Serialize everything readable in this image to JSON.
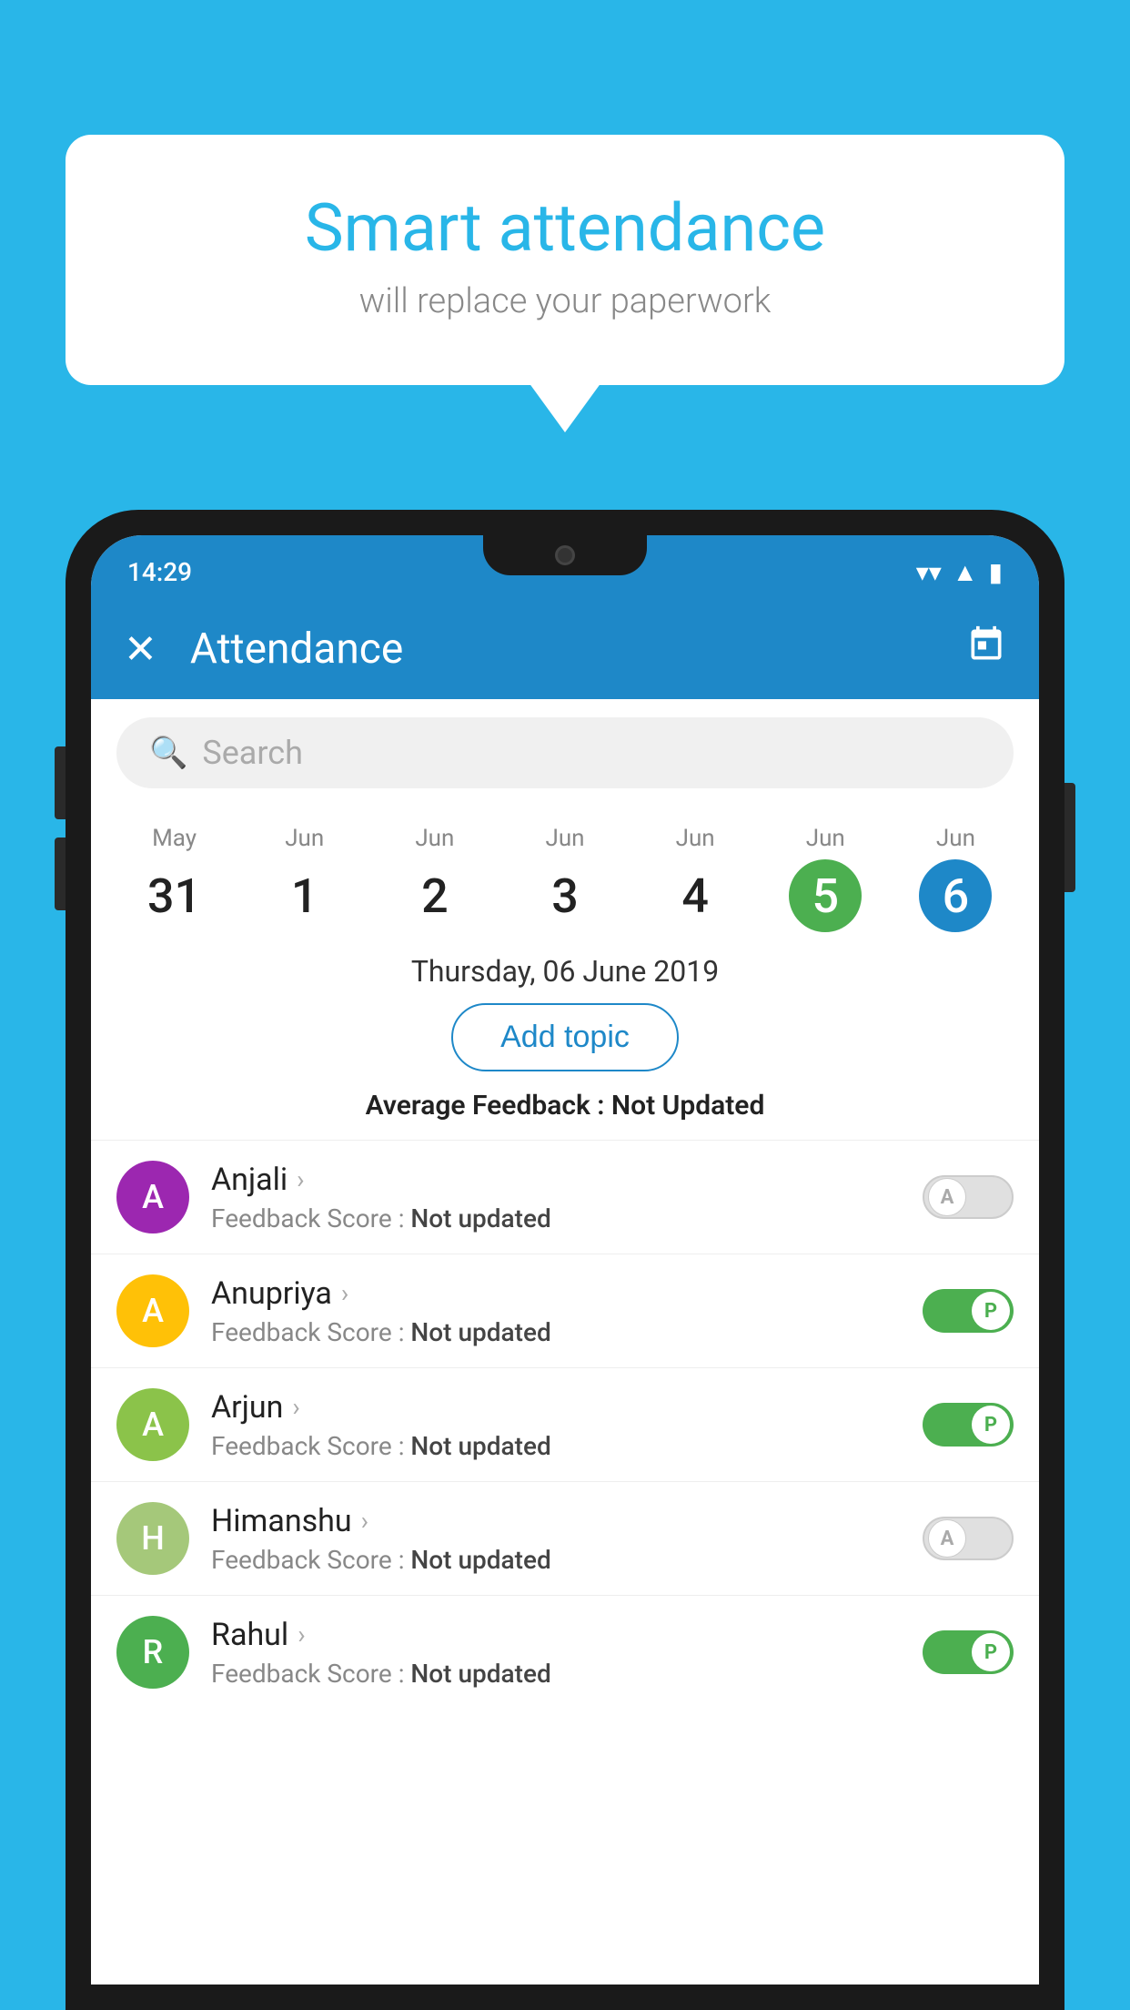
{
  "background_color": "#29b6e8",
  "bubble": {
    "title": "Smart attendance",
    "subtitle": "will replace your paperwork"
  },
  "status_bar": {
    "time": "14:29",
    "wifi_icon": "▼",
    "signal_icon": "▲",
    "battery_icon": "▮"
  },
  "app_bar": {
    "title": "Attendance",
    "close_label": "✕",
    "calendar_icon": "📅"
  },
  "search": {
    "placeholder": "Search"
  },
  "dates": [
    {
      "month": "May",
      "day": "31",
      "state": "normal"
    },
    {
      "month": "Jun",
      "day": "1",
      "state": "normal"
    },
    {
      "month": "Jun",
      "day": "2",
      "state": "normal"
    },
    {
      "month": "Jun",
      "day": "3",
      "state": "normal"
    },
    {
      "month": "Jun",
      "day": "4",
      "state": "normal"
    },
    {
      "month": "Jun",
      "day": "5",
      "state": "today"
    },
    {
      "month": "Jun",
      "day": "6",
      "state": "selected"
    }
  ],
  "selected_date_label": "Thursday, 06 June 2019",
  "add_topic_label": "Add topic",
  "avg_feedback_label": "Average Feedback : ",
  "avg_feedback_value": "Not Updated",
  "students": [
    {
      "name": "Anjali",
      "avatar_letter": "A",
      "avatar_color": "#9c27b0",
      "feedback_label": "Feedback Score : ",
      "feedback_value": "Not updated",
      "toggle_state": "off",
      "toggle_label": "A"
    },
    {
      "name": "Anupriya",
      "avatar_letter": "A",
      "avatar_color": "#ffc107",
      "feedback_label": "Feedback Score : ",
      "feedback_value": "Not updated",
      "toggle_state": "on",
      "toggle_label": "P"
    },
    {
      "name": "Arjun",
      "avatar_letter": "A",
      "avatar_color": "#8bc34a",
      "feedback_label": "Feedback Score : ",
      "feedback_value": "Not updated",
      "toggle_state": "on",
      "toggle_label": "P"
    },
    {
      "name": "Himanshu",
      "avatar_letter": "H",
      "avatar_color": "#a5c87a",
      "feedback_label": "Feedback Score : ",
      "feedback_value": "Not updated",
      "toggle_state": "off",
      "toggle_label": "A"
    },
    {
      "name": "Rahul",
      "avatar_letter": "R",
      "avatar_color": "#4caf50",
      "feedback_label": "Feedback Score : ",
      "feedback_value": "Not updated",
      "toggle_state": "on",
      "toggle_label": "P"
    }
  ]
}
